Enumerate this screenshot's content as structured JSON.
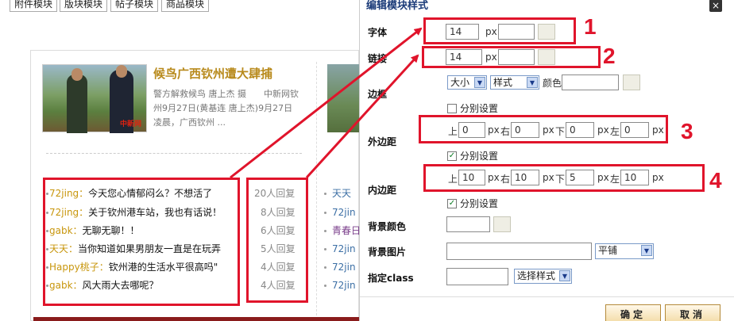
{
  "module_tabs": [
    "附件模块",
    "版块模块",
    "帖子模块",
    "商品模块"
  ],
  "news": {
    "title": "候鸟广西钦州遭大肆捕",
    "desc": "警方解救候鸟 唐上杰 摄　　中新网钦州9月27日(黄基连 唐上杰)9月27日凌晨，广西钦州 ...",
    "watermark": "中新网"
  },
  "threads": [
    {
      "user": "72jing：",
      "title": "今天您心情郁闷么？不想活了",
      "replies": "20人回复"
    },
    {
      "user": "72jing：",
      "title": "关于钦州港车站，我也有话说！",
      "replies": "8人回复"
    },
    {
      "user": "gabk：",
      "title": "无聊无聊！！",
      "replies": "6人回复"
    },
    {
      "user": "天天：",
      "title": "当你知道如果男朋友一直是在玩弄",
      "replies": "5人回复"
    },
    {
      "user": "Happy桃子：",
      "title": "钦州港的生活水平很高吗\"",
      "replies": "4人回复"
    },
    {
      "user": "gabk：",
      "title": "风大雨大去哪呢？",
      "replies": "4人回复"
    }
  ],
  "threads2": [
    "天天",
    "72jin",
    "青春日",
    "72jin",
    "72jin",
    "72jin"
  ],
  "dialog": {
    "title": "编辑模块样式",
    "close": "×",
    "font_label": "字体",
    "font_size": "14",
    "link_label": "链接",
    "link_size": "14",
    "px": "px",
    "border_label": "边框",
    "border_size_option": "大小",
    "border_style_option": "样式",
    "color_label": "颜色",
    "separate_label": "分别设置",
    "margin_label": "外边距",
    "padding_label": "内边距",
    "top": "上",
    "right": "右",
    "bottom": "下",
    "left": "左",
    "margin": {
      "top": "0",
      "right": "0",
      "bottom": "0",
      "left": "0"
    },
    "padding": {
      "top": "10",
      "right": "10",
      "bottom": "5",
      "left": "10"
    },
    "bgcolor_label": "背景颜色",
    "bgimage_label": "背景图片",
    "repeat_option": "平铺",
    "class_label": "指定class",
    "class_option": "选择样式",
    "ok": "确定",
    "cancel": "取消",
    "border_separate_checked": false,
    "margin_separate_checked": true,
    "padding_separate_checked": true
  },
  "annotations": [
    "1",
    "2",
    "3",
    "4"
  ],
  "colors": {
    "annotation": "#e0142b",
    "title": "#1a3a78",
    "username": "#c8960c"
  }
}
